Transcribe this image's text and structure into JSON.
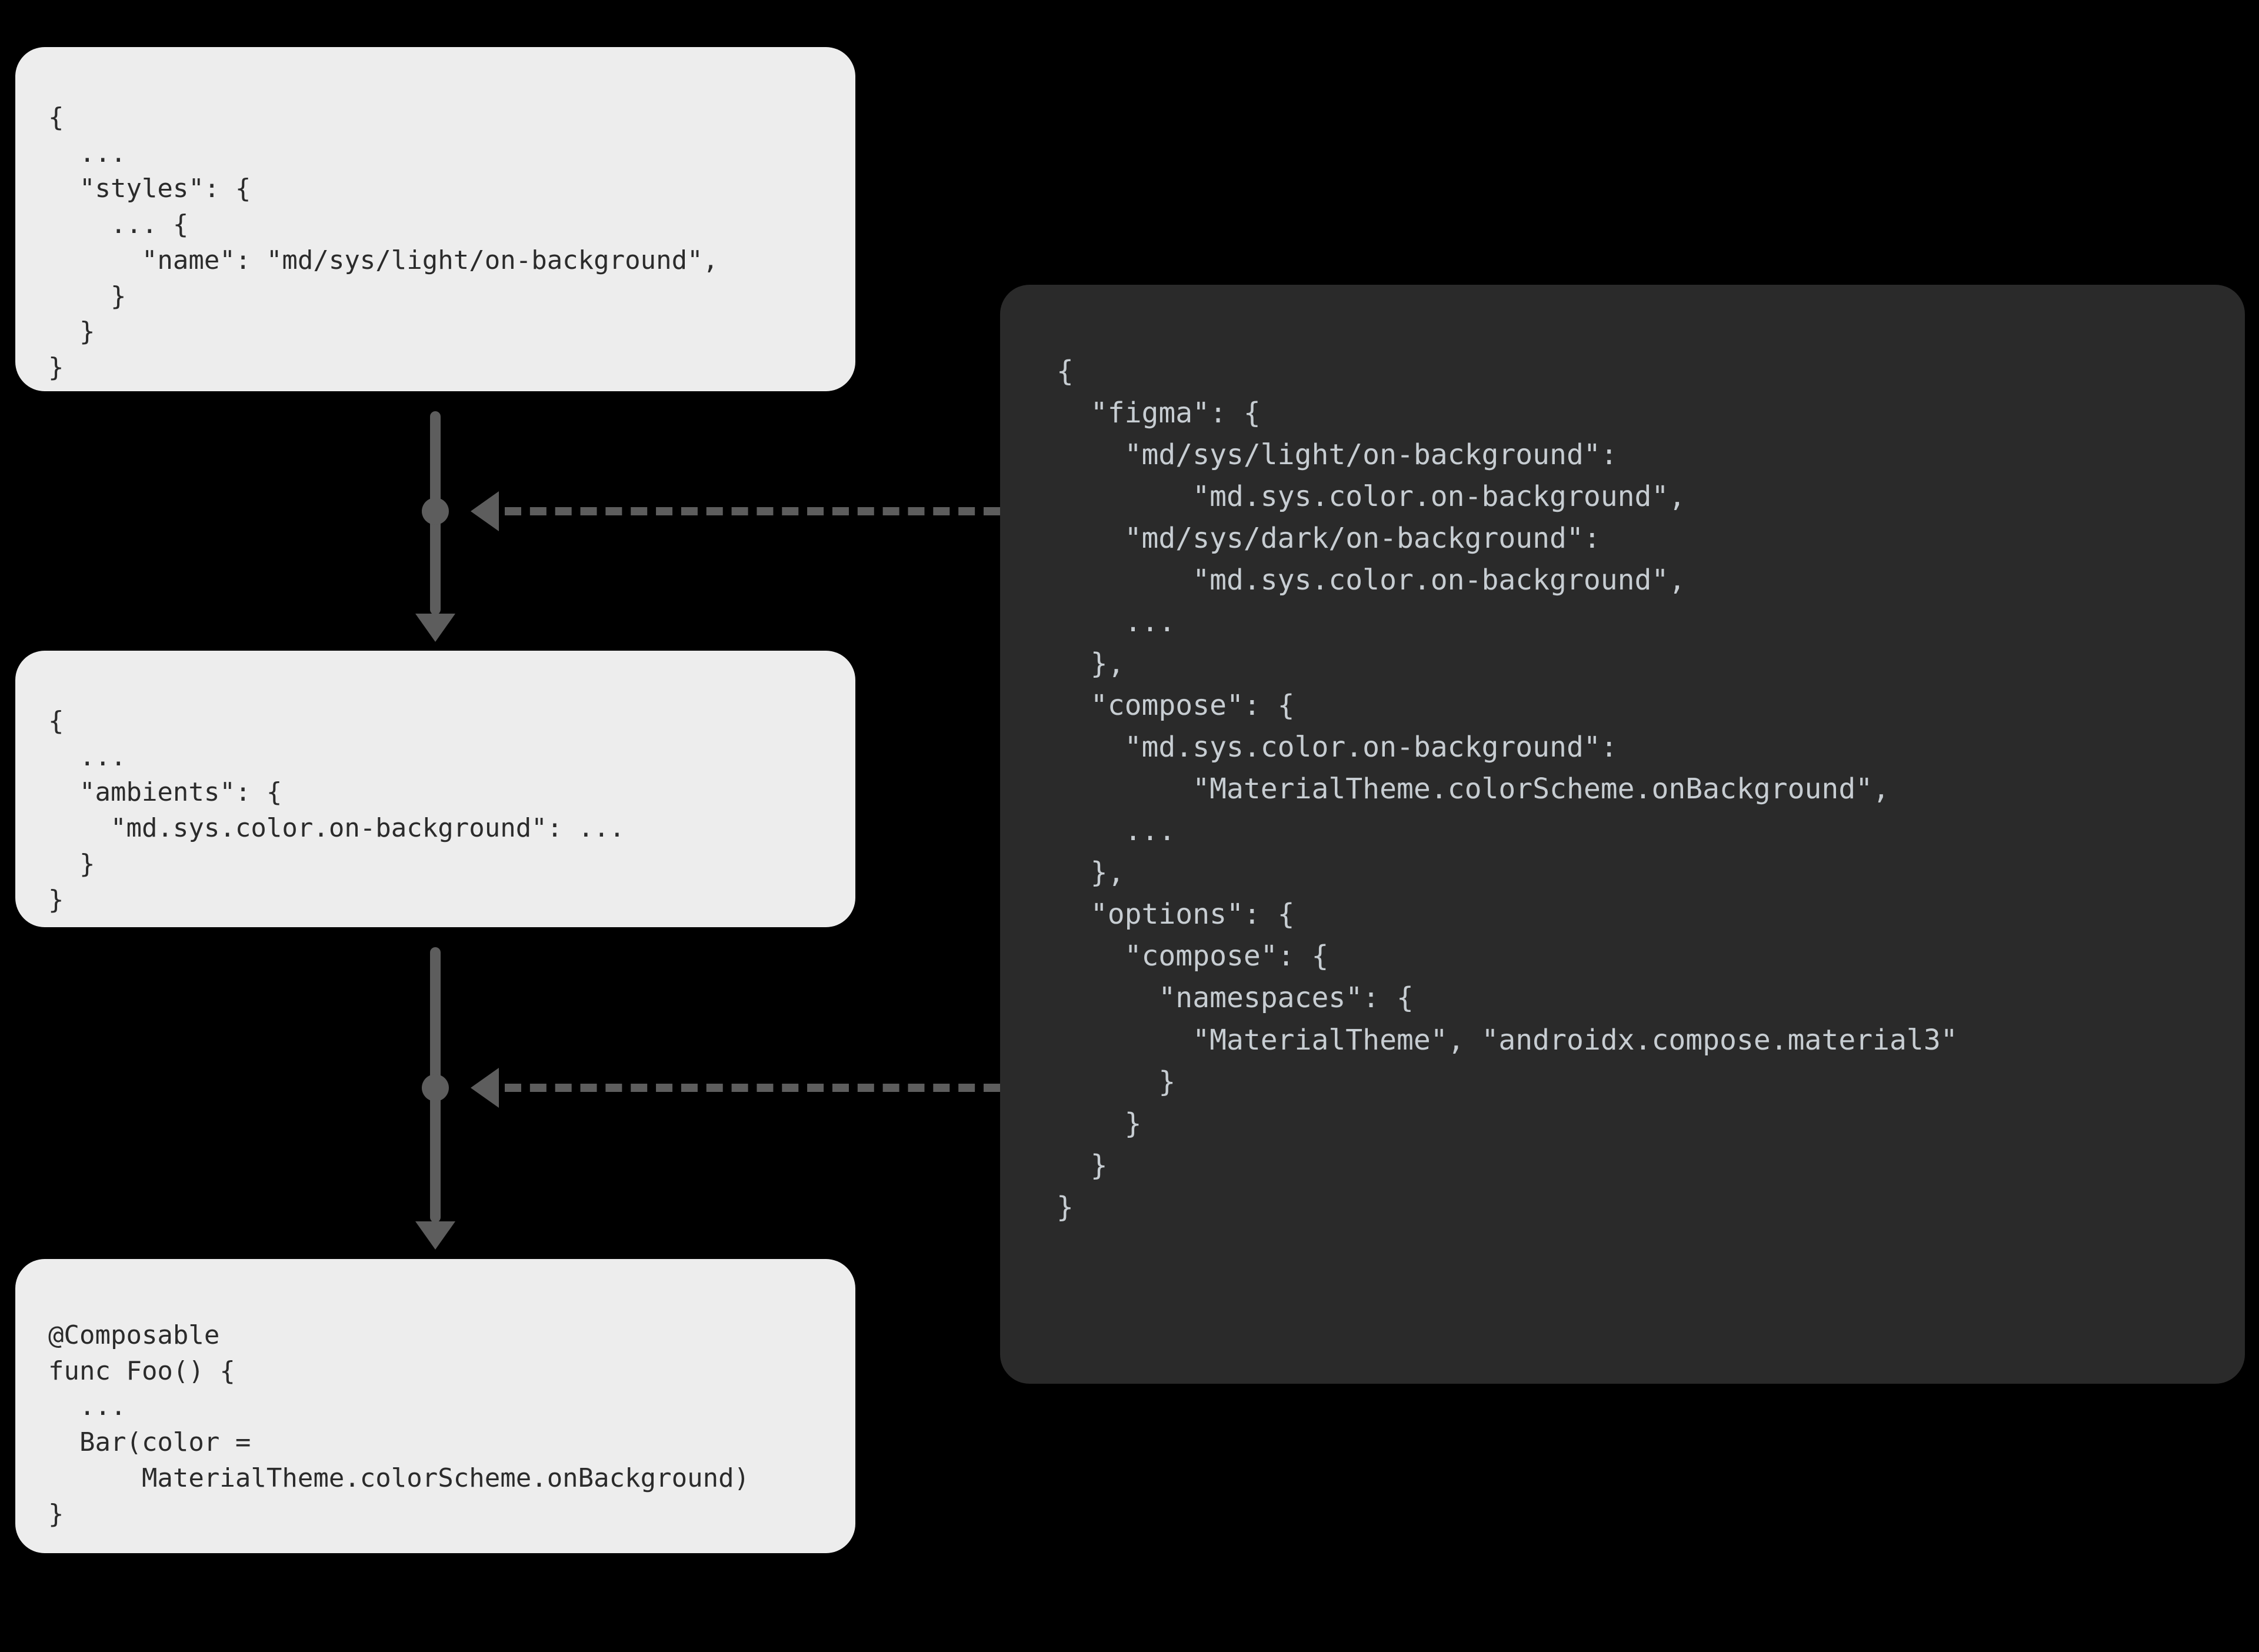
{
  "colors": {
    "bg": "#000000",
    "light_box": "#ededed",
    "dark_box": "#2a2a2a",
    "arrow": "#5d5d5d",
    "light_text": "#2b2b2b",
    "dark_text": "#c7cdd2"
  },
  "top_box": {
    "code": "{\n  ...\n  \"styles\": {\n    ... {\n      \"name\": \"md/sys/light/on-background\",\n    }\n  }\n}"
  },
  "middle_box": {
    "code": "{\n  ...\n  \"ambients\": {\n    \"md.sys.color.on-background\": ...\n  }\n}"
  },
  "bottom_box": {
    "code": "@Composable\nfunc Foo() {\n  ...\n  Bar(color =\n      MaterialTheme.colorScheme.onBackground)\n}"
  },
  "config_box": {
    "code": "{\n  \"figma\": {\n    \"md/sys/light/on-background\":\n        \"md.sys.color.on-background\",\n    \"md/sys/dark/on-background\":\n        \"md.sys.color.on-background\",\n    ...\n  },\n  \"compose\": {\n    \"md.sys.color.on-background\":\n        \"MaterialTheme.colorScheme.onBackground\",\n    ...\n  },\n  \"options\": {\n    \"compose\": {\n      \"namespaces\": {\n        \"MaterialTheme\", \"androidx.compose.material3\"\n      }\n    }\n  }\n}"
  },
  "flow": {
    "step1_to_step2": "transform",
    "step2_to_step3": "transform",
    "config_feeds_step1": true,
    "config_feeds_step2": true
  }
}
